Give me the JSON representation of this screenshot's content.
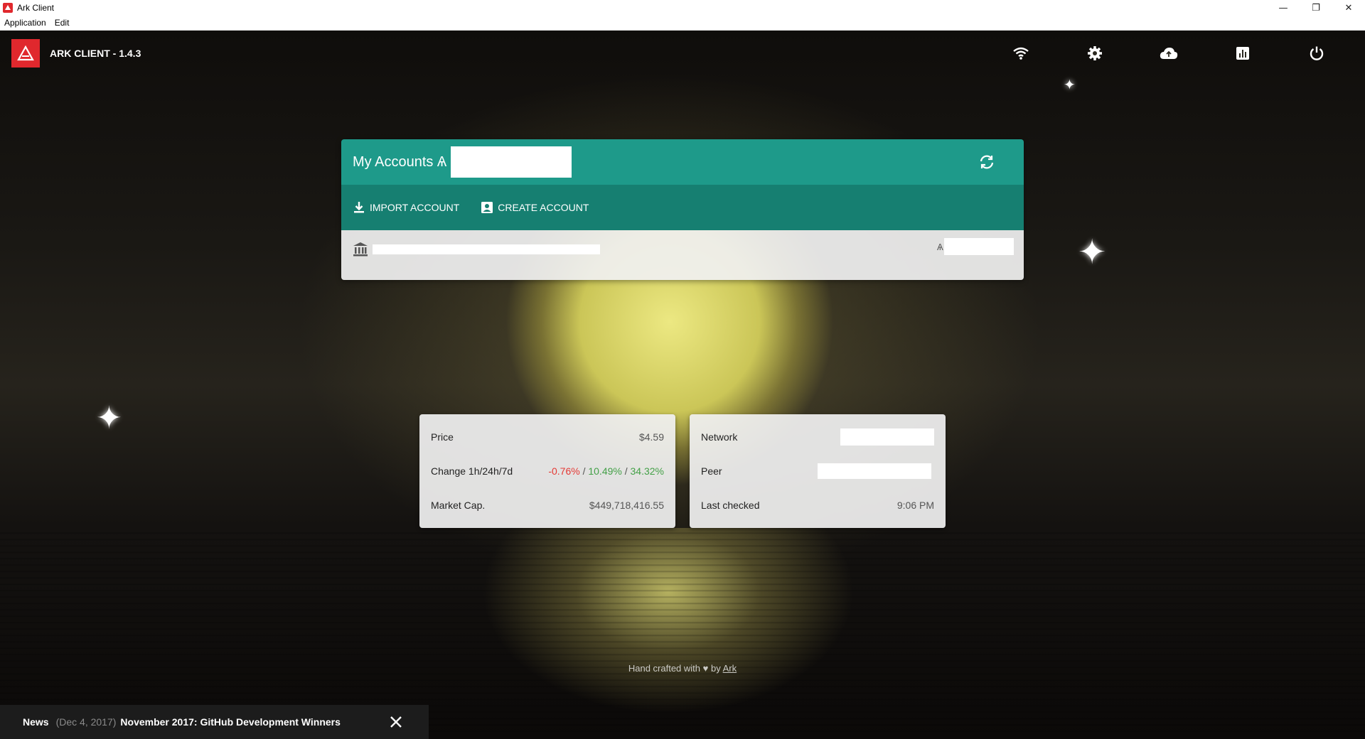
{
  "window": {
    "title": "Ark Client",
    "controls": {
      "minimize": "—",
      "restore": "❐",
      "close": "✕"
    }
  },
  "menubar": {
    "items": [
      "Application",
      "Edit"
    ]
  },
  "header": {
    "app_title": "ARK CLIENT - 1.4.3",
    "icons": [
      "wifi-icon",
      "settings-icon",
      "cloud-upload-icon",
      "chart-icon",
      "power-icon"
    ]
  },
  "accounts": {
    "title": "My Accounts Ѧ",
    "actions": {
      "import": "IMPORT ACCOUNT",
      "create": "CREATE ACCOUNT"
    },
    "row": {
      "balance_symbol": "Ѧ"
    }
  },
  "market": {
    "price_label": "Price",
    "price_value": "$4.59",
    "change_label": "Change 1h/24h/7d",
    "change_1h": "-0.76%",
    "change_24h": "10.49%",
    "change_7d": "34.32%",
    "separator": " / ",
    "marketcap_label": "Market Cap.",
    "marketcap_value": "$449,718,416.55"
  },
  "network": {
    "network_label": "Network",
    "peer_label": "Peer",
    "last_checked_label": "Last checked",
    "last_checked_value": "9:06 PM"
  },
  "footer": {
    "prefix": "Hand crafted with",
    "heart": "♥",
    "by": "by",
    "link": "Ark"
  },
  "news": {
    "label": "News",
    "date": "(Dec 4, 2017)",
    "title": "November 2017: GitHub Development Winners"
  },
  "colors": {
    "brand_red": "#e0282d",
    "teal_header": "#1e9a8a",
    "teal_actions": "#167f71",
    "negative": "#e53935",
    "positive": "#43a047"
  }
}
